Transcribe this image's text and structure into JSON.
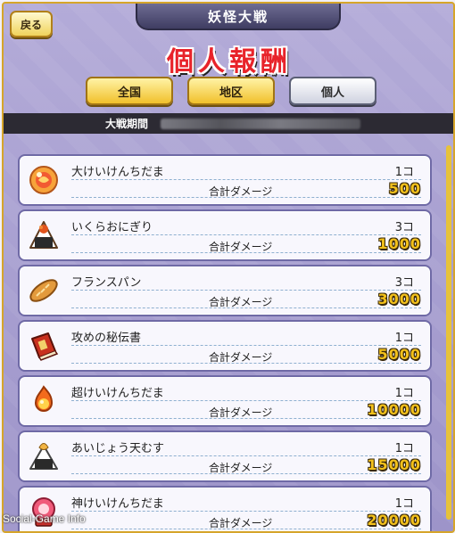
{
  "header": {
    "back_label": "戻る",
    "banner_title": "妖怪大戦",
    "page_title": "個人報酬"
  },
  "tabs": [
    {
      "label": "全国",
      "state": "inactive"
    },
    {
      "label": "地区",
      "state": "inactive"
    },
    {
      "label": "個人",
      "state": "active"
    }
  ],
  "period": {
    "label": "大戦期間"
  },
  "damage_label": "合計ダメージ",
  "rewards": [
    {
      "name": "大けいけんちだま",
      "qty": "1コ",
      "damage": "500",
      "icon": "orb-icon"
    },
    {
      "name": "いくらおにぎり",
      "qty": "3コ",
      "damage": "1000",
      "icon": "onigiri-icon"
    },
    {
      "name": "フランスパン",
      "qty": "3コ",
      "damage": "3000",
      "icon": "bread-icon"
    },
    {
      "name": "攻めの秘伝書",
      "qty": "1コ",
      "damage": "5000",
      "icon": "book-icon"
    },
    {
      "name": "超けいけんちだま",
      "qty": "1コ",
      "damage": "10000",
      "icon": "flame-orb-icon"
    },
    {
      "name": "あいじょう天むす",
      "qty": "1コ",
      "damage": "15000",
      "icon": "tenmusu-icon"
    },
    {
      "name": "神けいけんちだま",
      "qty": "1コ",
      "damage": "20000",
      "icon": "divine-orb-icon"
    }
  ],
  "watermark": "Social-Game Info",
  "colors": {
    "accent_gold": "#f1c02b",
    "title_red": "#e8232a",
    "panel_purple": "#a59dd0"
  }
}
